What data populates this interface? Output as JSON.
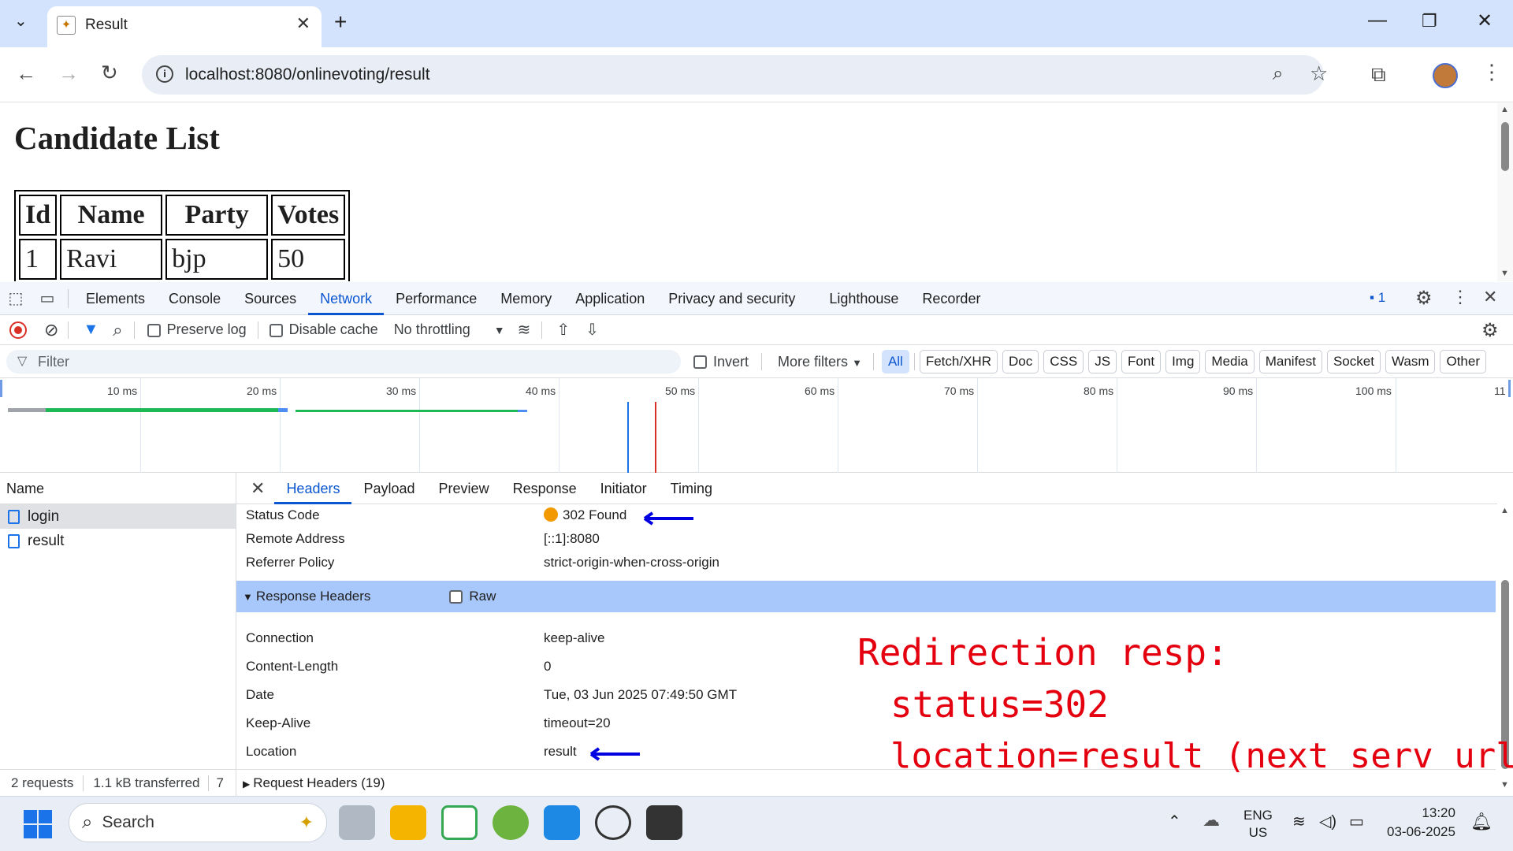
{
  "browser": {
    "tab_title": "Result",
    "new_tab": "+",
    "url": "localhost:8080/onlinevoting/result"
  },
  "page": {
    "heading": "Candidate List",
    "table": {
      "headers": [
        "Id",
        "Name",
        "Party",
        "Votes"
      ],
      "rows": [
        [
          "1",
          "Ravi",
          "bjp",
          "50"
        ]
      ]
    }
  },
  "devtools": {
    "tabs": [
      "Elements",
      "Console",
      "Sources",
      "Network",
      "Performance",
      "Memory",
      "Application",
      "Privacy and security",
      "Lighthouse",
      "Recorder"
    ],
    "active_tab": "Network",
    "issues_count": "1",
    "toolbar": {
      "preserve_log": "Preserve log",
      "disable_cache": "Disable cache",
      "throttling": "No throttling"
    },
    "filter": {
      "placeholder": "Filter",
      "invert": "Invert",
      "more_filters": "More filters",
      "chips": [
        "All",
        "Fetch/XHR",
        "Doc",
        "CSS",
        "JS",
        "Font",
        "Img",
        "Media",
        "Manifest",
        "Socket",
        "Wasm",
        "Other"
      ],
      "active_chip": "All"
    },
    "timeline_ticks": [
      "10 ms",
      "20 ms",
      "30 ms",
      "40 ms",
      "50 ms",
      "60 ms",
      "70 ms",
      "80 ms",
      "90 ms",
      "100 ms",
      "11"
    ],
    "requests": {
      "header": "Name",
      "items": [
        "login",
        "result"
      ],
      "selected": "login",
      "summary_count": "2 requests",
      "summary_transfer": "1.1 kB transferred",
      "summary_more": "7"
    },
    "detail": {
      "tabs": [
        "Headers",
        "Payload",
        "Preview",
        "Response",
        "Initiator",
        "Timing"
      ],
      "active_tab": "Headers",
      "general": [
        {
          "key": "Status Code",
          "value": "302 Found"
        },
        {
          "key": "Remote Address",
          "value": "[::1]:8080"
        },
        {
          "key": "Referrer Policy",
          "value": "strict-origin-when-cross-origin"
        }
      ],
      "response_headers_title": "Response Headers",
      "raw_label": "Raw",
      "response_headers": [
        {
          "key": "Connection",
          "value": "keep-alive"
        },
        {
          "key": "Content-Length",
          "value": "0"
        },
        {
          "key": "Date",
          "value": "Tue, 03 Jun 2025 07:49:50 GMT"
        },
        {
          "key": "Keep-Alive",
          "value": "timeout=20"
        },
        {
          "key": "Location",
          "value": "result"
        }
      ],
      "request_headers_title": "Request Headers (19)"
    }
  },
  "annotation": {
    "line1": "Redirection resp:",
    "line2": "status=302",
    "line3": "location=result (next serv url)"
  },
  "taskbar": {
    "search_placeholder": "Search",
    "lang1": "ENG",
    "lang2": "US",
    "time": "13:20",
    "date": "03-06-2025"
  },
  "colors": {
    "accent": "#0b57d0",
    "annotation": "#e4000f",
    "status_dot": "#f29900",
    "arrow": "#0000e0"
  }
}
